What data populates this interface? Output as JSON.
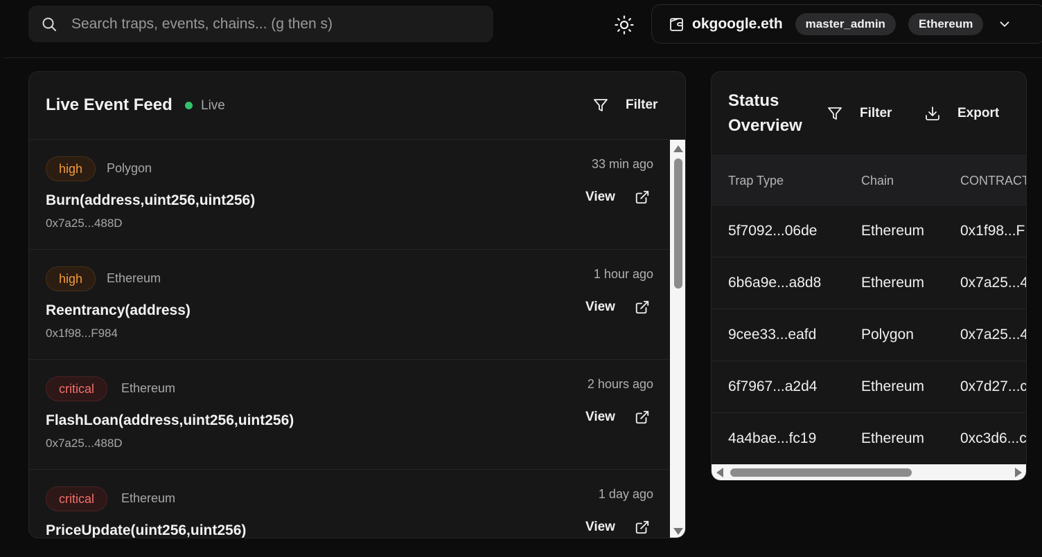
{
  "search": {
    "placeholder": "Search traps, events, chains... (g then s)"
  },
  "wallet": {
    "name": "okgoogle.eth",
    "role": "master_admin",
    "network": "Ethereum"
  },
  "feed": {
    "title": "Live Event Feed",
    "live_label": "Live",
    "filter_label": "Filter",
    "view_label": "View",
    "events": [
      {
        "severity": "high",
        "chain": "Polygon",
        "time": "33 min ago",
        "signature": "Burn(address,uint256,uint256)",
        "address": "0x7a25...488D"
      },
      {
        "severity": "high",
        "chain": "Ethereum",
        "time": "1 hour ago",
        "signature": "Reentrancy(address)",
        "address": "0x1f98...F984"
      },
      {
        "severity": "critical",
        "chain": "Ethereum",
        "time": "2 hours ago",
        "signature": "FlashLoan(address,uint256,uint256)",
        "address": "0x7a25...488D"
      },
      {
        "severity": "critical",
        "chain": "Ethereum",
        "time": "1 day ago",
        "signature": "PriceUpdate(uint256,uint256)",
        "address": ""
      }
    ]
  },
  "status": {
    "title": "Status Overview",
    "filter_label": "Filter",
    "export_label": "Export",
    "columns": [
      "Trap Type",
      "Chain",
      "CONTRACT"
    ],
    "rows": [
      [
        "5f7092...06de",
        "Ethereum",
        "0x1f98...F"
      ],
      [
        "6b6a9e...a8d8",
        "Ethereum",
        "0x7a25...4"
      ],
      [
        "9cee33...eafd",
        "Polygon",
        "0x7a25...4"
      ],
      [
        "6f7967...a2d4",
        "Ethereum",
        "0x7d27...c"
      ],
      [
        "4a4bae...fc19",
        "Ethereum",
        "0xc3d6...c"
      ]
    ]
  },
  "colors": {
    "background": "#0c0c0d",
    "panel": "#171718",
    "live": "#34c06b",
    "high": "#f39a3c",
    "critical": "#f2706a"
  },
  "icons": [
    "search-icon",
    "sun-icon",
    "wallet-icon",
    "chevron-down-icon",
    "filter-icon",
    "external-link-icon",
    "download-icon"
  ]
}
